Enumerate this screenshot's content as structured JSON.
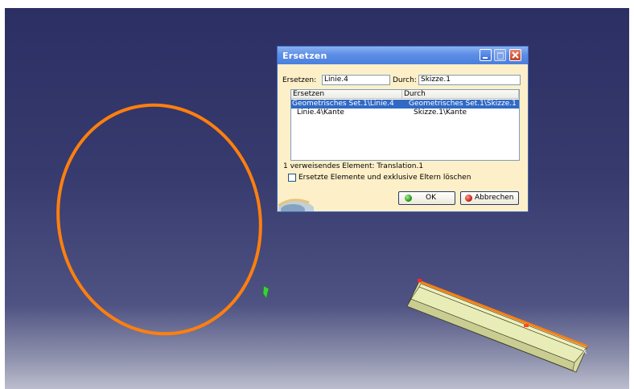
{
  "dialog": {
    "title": "Ersetzen",
    "replace_label": "Ersetzen:",
    "replace_value": "Linie.4",
    "by_label": "Durch:",
    "by_value": "Skizze.1",
    "columns": [
      "Ersetzen",
      "Durch"
    ],
    "rows": [
      {
        "ersetzen": "Geometrisches Set.1\\Linie.4",
        "durch": "Geometrisches Set.1\\Skizze.1",
        "selected": true
      },
      {
        "ersetzen": "Linie.4\\Kante",
        "durch": "Skizze.1\\Kante",
        "selected": false
      }
    ],
    "referencing_text": "1 verweisendes Element: Translation.1",
    "checkbox_label": "Ersetzte Elemente und exklusive Eltern löschen",
    "checkbox_checked": false,
    "ok_label": "OK",
    "cancel_label": "Abbrechen"
  },
  "colors": {
    "background_top": "#2c2f63",
    "background_bottom": "#bcbdce",
    "curve": "#ff7f0e",
    "surface": "#e4e8b0",
    "dialog_bg": "#fdf0c8",
    "titlebar": "#4a7fde",
    "selection": "#316ac5"
  },
  "icons": [
    "minimize-icon",
    "maximize-icon",
    "close-icon",
    "ok-green-dot-icon",
    "cancel-red-dot-icon",
    "catia-logo-icon",
    "green-arrow-icon"
  ]
}
